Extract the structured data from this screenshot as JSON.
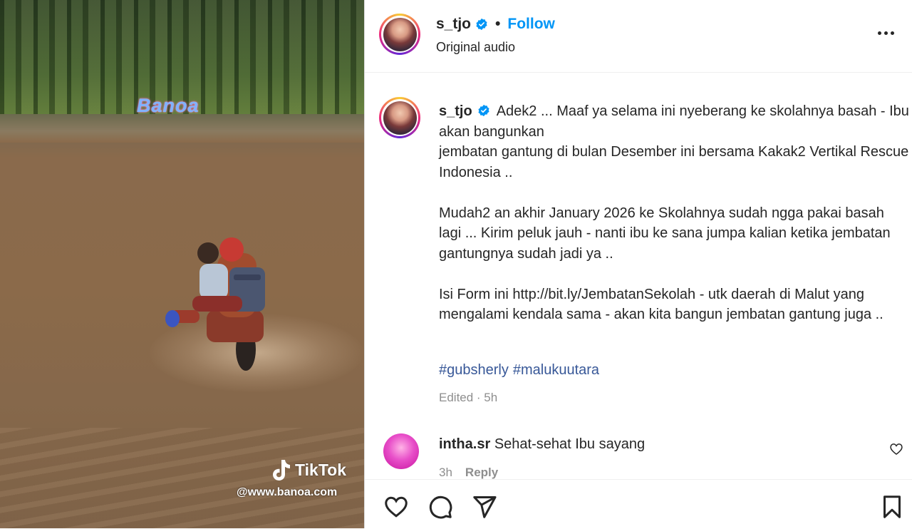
{
  "media": {
    "watermark": "Banoa",
    "tiktok_label": "TikTok",
    "tiktok_handle": "@www.banoa.com"
  },
  "header": {
    "username": "s_tjo",
    "separator": "•",
    "follow_label": "Follow",
    "audio_label": "Original audio"
  },
  "caption": {
    "username": "s_tjo",
    "paragraphs": [
      "Adek2 ... Maaf ya selama ini nyeberang ke skolahnya basah - Ibu akan bangunkan",
      "jembatan gantung di bulan Desember ini bersama Kakak2 Vertikal Rescue Indonesia ..",
      "Mudah2 an akhir January 2026 ke Skolahnya sudah ngga pakai basah lagi ... Kirim peluk jauh - nanti ibu ke sana jumpa kalian ketika jembatan gantungnya sudah jadi ya ..",
      "Isi Form ini http://bit.ly/JembatanSekolah - utk daerah di Malut yang mengalami kendala sama - akan kita bangun jembatan gantung juga .."
    ],
    "hashtags": [
      "#gubsherly",
      "#malukuutara"
    ],
    "edited": "Edited · 5h"
  },
  "comment": {
    "username": "intha.sr",
    "text": "Sehat-sehat Ibu sayang",
    "time": "3h",
    "reply_label": "Reply"
  },
  "icons": {
    "verified": "verified-badge-icon",
    "more": "more-options-icon",
    "like": "heart-icon",
    "comment": "comment-icon",
    "share": "share-icon",
    "save": "bookmark-icon"
  },
  "colors": {
    "follow": "#0095f6",
    "verified": "#0095f6",
    "hashtag": "#385898",
    "muted": "#8e8e8e"
  }
}
